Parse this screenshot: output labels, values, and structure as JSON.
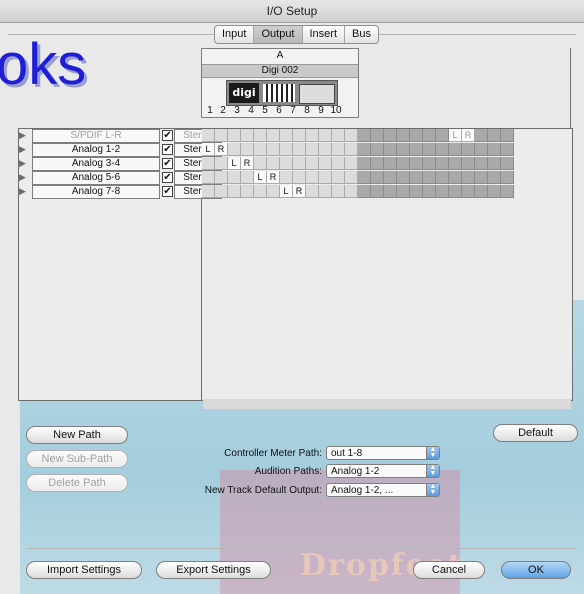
{
  "window": {
    "title": "I/O Setup"
  },
  "tabs": [
    {
      "label": "Input",
      "active": false
    },
    {
      "label": "Output",
      "active": true
    },
    {
      "label": "Insert",
      "active": false
    },
    {
      "label": "Bus",
      "active": false
    }
  ],
  "watermark": {
    "logo_text": "oks",
    "footer_text": "Dropfeet"
  },
  "device": {
    "column_letter": "A",
    "name": "Digi 002",
    "logo_text": "digi",
    "channels": [
      "1",
      "2",
      "3",
      "4",
      "5",
      "6",
      "7",
      "8",
      "9",
      "10"
    ]
  },
  "paths": [
    {
      "name": "S/PDIF L-R",
      "format": "Stereo",
      "checked": true,
      "active": false,
      "assign": {
        "L": 19,
        "R": 20
      }
    },
    {
      "name": "Analog 1-2",
      "format": "Stereo",
      "checked": true,
      "active": true,
      "assign": {
        "L": 0,
        "R": 1
      }
    },
    {
      "name": "Analog 3-4",
      "format": "Stereo",
      "checked": true,
      "active": true,
      "assign": {
        "L": 2,
        "R": 3
      }
    },
    {
      "name": "Analog 5-6",
      "format": "Stereo",
      "checked": true,
      "active": true,
      "assign": {
        "L": 4,
        "R": 5
      }
    },
    {
      "name": "Analog 7-8",
      "format": "Stereo",
      "checked": true,
      "active": true,
      "assign": {
        "L": 6,
        "R": 7
      }
    }
  ],
  "buttons": {
    "new_path": "New Path",
    "new_sub_path": "New Sub-Path",
    "delete_path": "Delete Path",
    "default": "Default",
    "import_settings": "Import Settings",
    "export_settings": "Export Settings",
    "cancel": "Cancel",
    "ok": "OK"
  },
  "settings": {
    "controller_meter_path": {
      "label": "Controller Meter Path:",
      "value": "out 1-8"
    },
    "audition_paths": {
      "label": "Audition Paths:",
      "value": "Analog 1-2"
    },
    "new_track_default_output": {
      "label": "New Track Default Output:",
      "value": "Analog 1-2, ..."
    }
  },
  "grid": {
    "columns": 24,
    "dark_from": 12
  },
  "colors": {
    "accent": "#5ea2e6",
    "grid_light": "#dcdcdc",
    "grid_dark": "#a9a9a9",
    "watermark_blue": "#1e1ed6"
  }
}
